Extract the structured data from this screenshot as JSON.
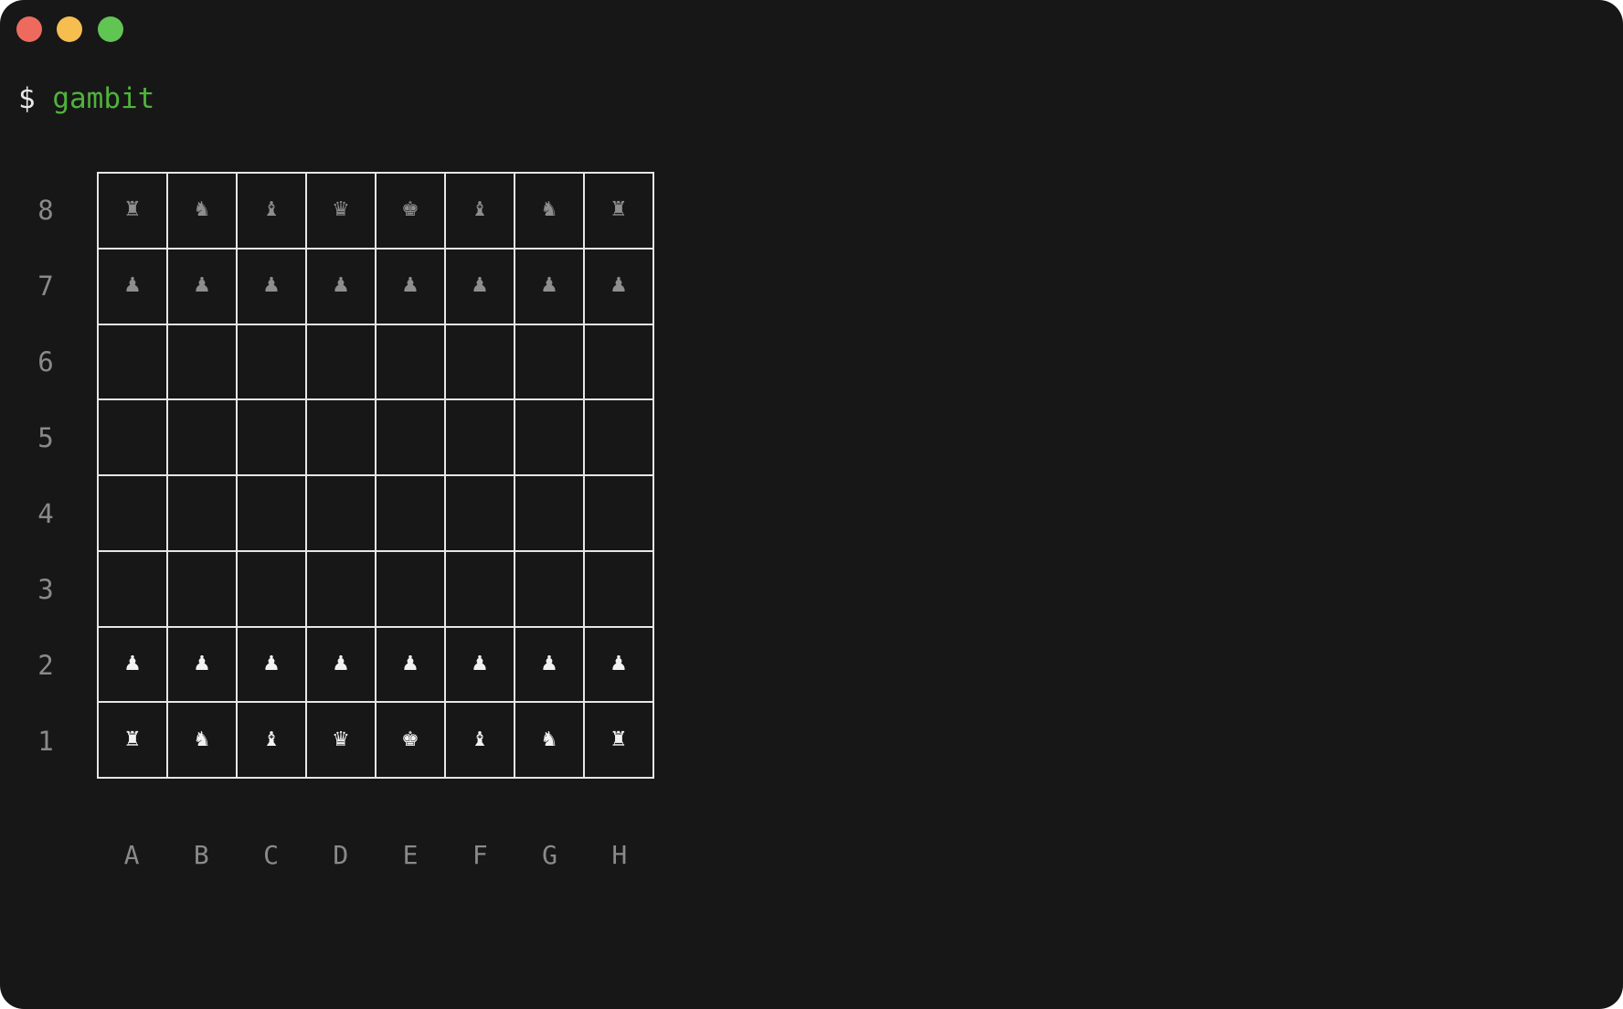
{
  "terminal": {
    "prompt_symbol": "$",
    "command": "gambit"
  },
  "board": {
    "ranks": [
      "8",
      "7",
      "6",
      "5",
      "4",
      "3",
      "2",
      "1"
    ],
    "files": [
      "A",
      "B",
      "C",
      "D",
      "E",
      "F",
      "G",
      "H"
    ],
    "squares": [
      [
        {
          "glyph": "♜",
          "side": "black",
          "piece": "rook"
        },
        {
          "glyph": "♞",
          "side": "black",
          "piece": "knight"
        },
        {
          "glyph": "♝",
          "side": "black",
          "piece": "bishop"
        },
        {
          "glyph": "♛",
          "side": "black",
          "piece": "queen"
        },
        {
          "glyph": "♚",
          "side": "black",
          "piece": "king"
        },
        {
          "glyph": "♝",
          "side": "black",
          "piece": "bishop"
        },
        {
          "glyph": "♞",
          "side": "black",
          "piece": "knight"
        },
        {
          "glyph": "♜",
          "side": "black",
          "piece": "rook"
        }
      ],
      [
        {
          "glyph": "♟",
          "side": "black",
          "piece": "pawn"
        },
        {
          "glyph": "♟",
          "side": "black",
          "piece": "pawn"
        },
        {
          "glyph": "♟",
          "side": "black",
          "piece": "pawn"
        },
        {
          "glyph": "♟",
          "side": "black",
          "piece": "pawn"
        },
        {
          "glyph": "♟",
          "side": "black",
          "piece": "pawn"
        },
        {
          "glyph": "♟",
          "side": "black",
          "piece": "pawn"
        },
        {
          "glyph": "♟",
          "side": "black",
          "piece": "pawn"
        },
        {
          "glyph": "♟",
          "side": "black",
          "piece": "pawn"
        }
      ],
      [
        null,
        null,
        null,
        null,
        null,
        null,
        null,
        null
      ],
      [
        null,
        null,
        null,
        null,
        null,
        null,
        null,
        null
      ],
      [
        null,
        null,
        null,
        null,
        null,
        null,
        null,
        null
      ],
      [
        null,
        null,
        null,
        null,
        null,
        null,
        null,
        null
      ],
      [
        {
          "glyph": "♟",
          "side": "white",
          "piece": "pawn"
        },
        {
          "glyph": "♟",
          "side": "white",
          "piece": "pawn"
        },
        {
          "glyph": "♟",
          "side": "white",
          "piece": "pawn"
        },
        {
          "glyph": "♟",
          "side": "white",
          "piece": "pawn"
        },
        {
          "glyph": "♟",
          "side": "white",
          "piece": "pawn"
        },
        {
          "glyph": "♟",
          "side": "white",
          "piece": "pawn"
        },
        {
          "glyph": "♟",
          "side": "white",
          "piece": "pawn"
        },
        {
          "glyph": "♟",
          "side": "white",
          "piece": "pawn"
        }
      ],
      [
        {
          "glyph": "♜",
          "side": "white",
          "piece": "rook"
        },
        {
          "glyph": "♞",
          "side": "white",
          "piece": "knight"
        },
        {
          "glyph": "♝",
          "side": "white",
          "piece": "bishop"
        },
        {
          "glyph": "♛",
          "side": "white",
          "piece": "queen"
        },
        {
          "glyph": "♚",
          "side": "white",
          "piece": "king"
        },
        {
          "glyph": "♝",
          "side": "white",
          "piece": "bishop"
        },
        {
          "glyph": "♞",
          "side": "white",
          "piece": "knight"
        },
        {
          "glyph": "♜",
          "side": "white",
          "piece": "rook"
        }
      ]
    ]
  },
  "colors": {
    "background": "#171717",
    "command": "#4fb33b",
    "grid": "#e6e6e6",
    "label": "#8a8a8a",
    "black_piece": "#8e8e8e",
    "white_piece": "#f2f2f2"
  }
}
